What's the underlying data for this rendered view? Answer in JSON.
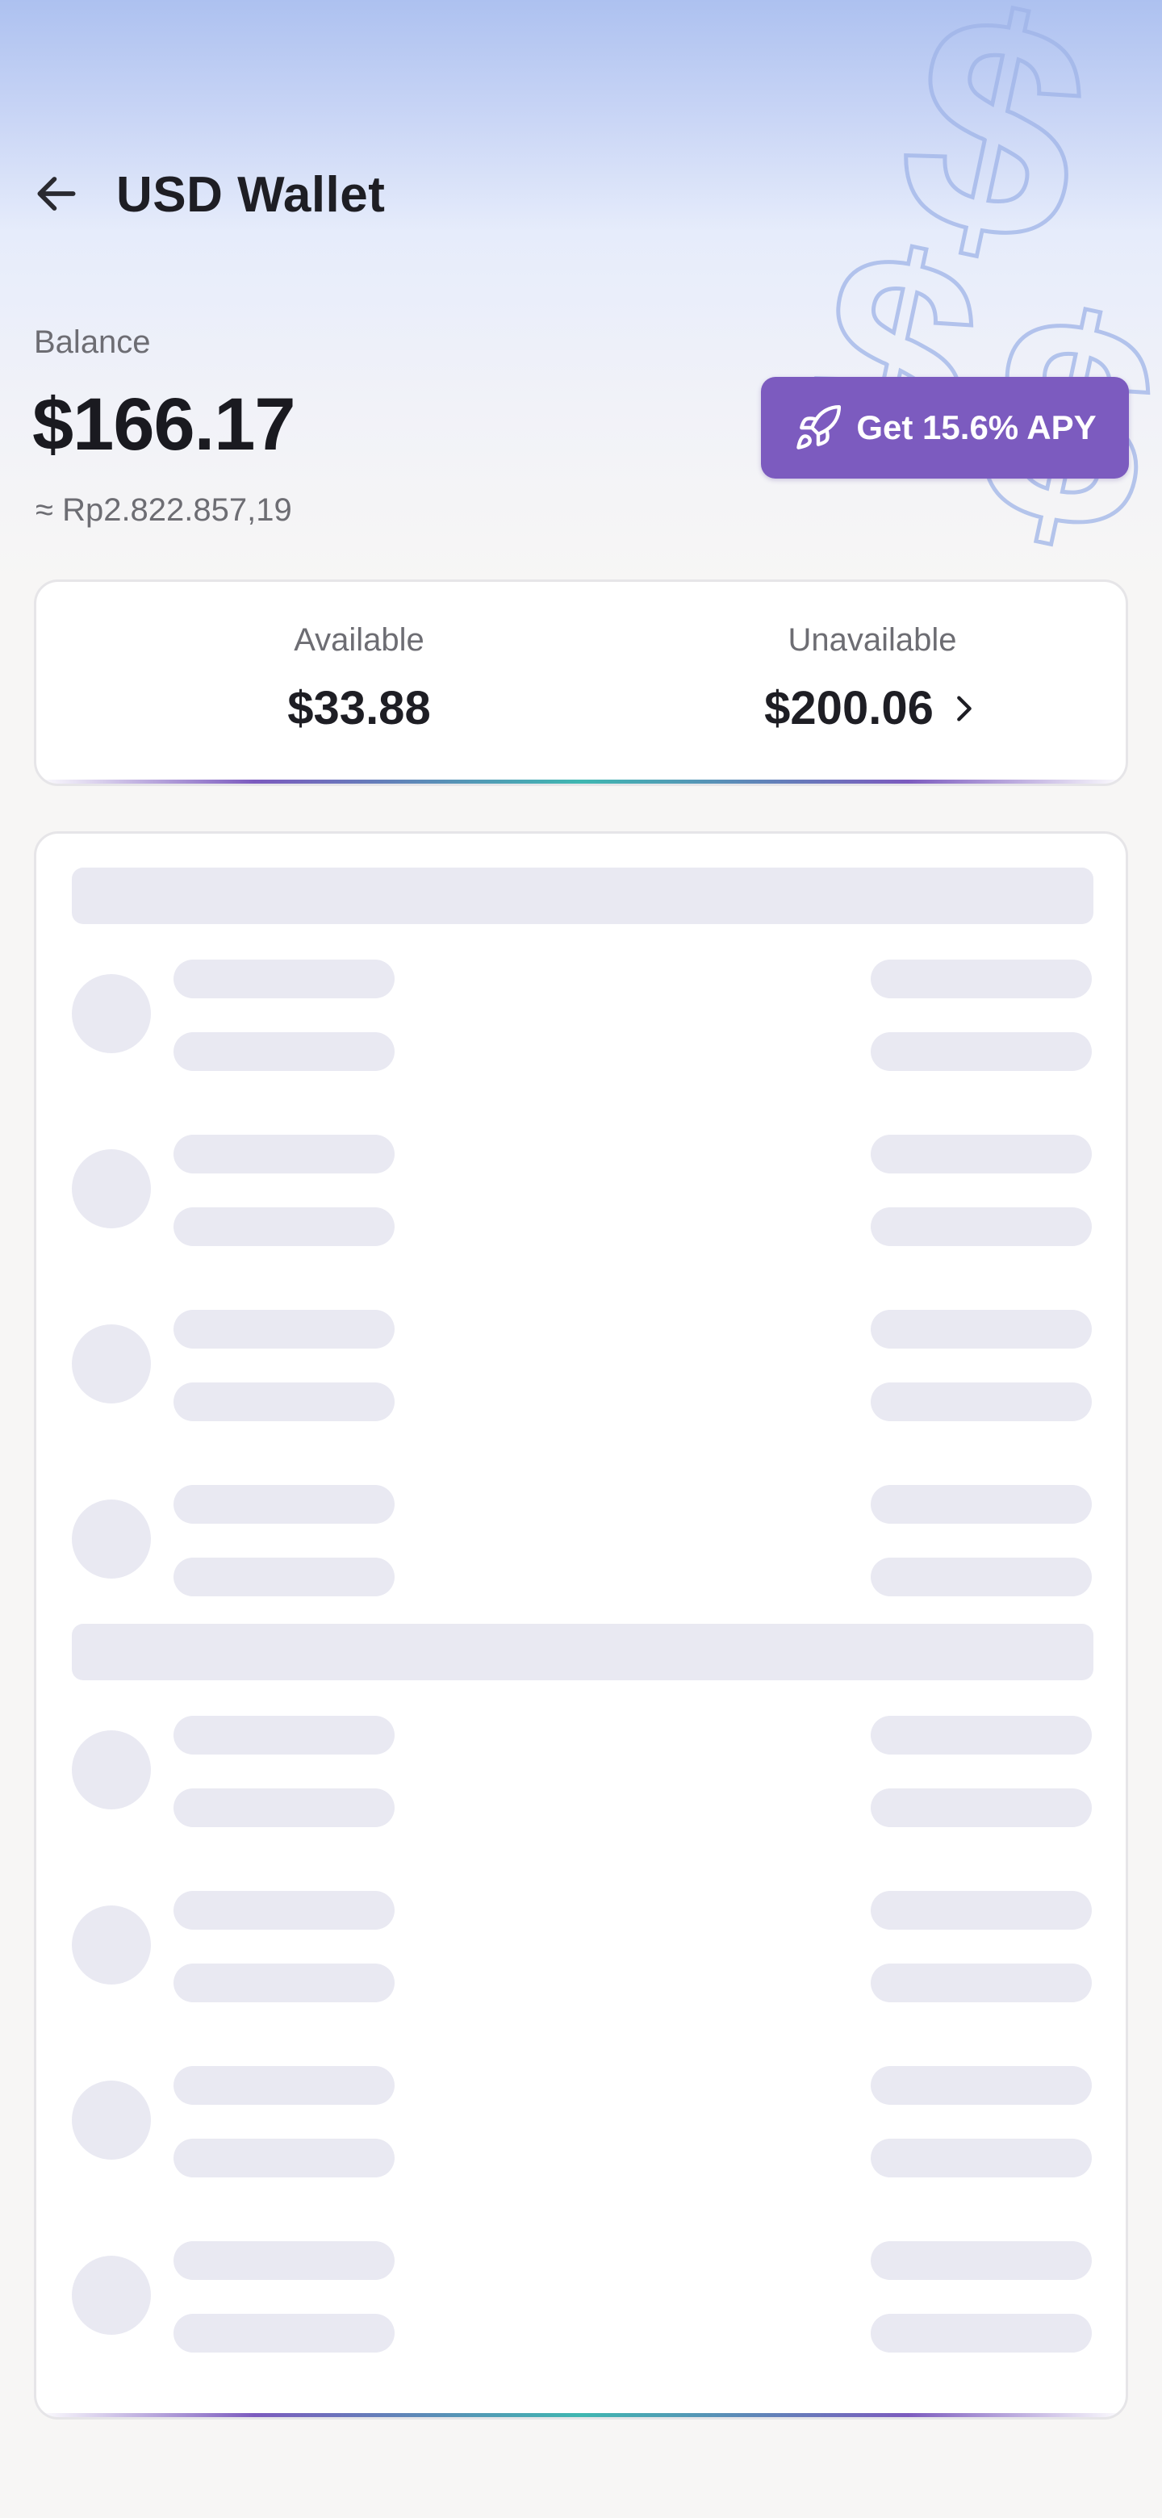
{
  "header": {
    "title": "USD Wallet",
    "back_icon": "arrow-left-icon"
  },
  "balance": {
    "label": "Balance",
    "value": "$166.17",
    "converted": "≈ Rp2.822.857,19"
  },
  "apy_button": {
    "label": "Get 15.6% APY",
    "icon": "rocket-icon"
  },
  "summary": {
    "available_label": "Available",
    "available_value": "$33.88",
    "unavailable_label": "Unavailable",
    "unavailable_value": "$200.06",
    "unavailable_icon": "chevron-right-icon"
  },
  "transactions": {
    "state": "loading",
    "groups": [
      {
        "placeholder_rows": 4
      },
      {
        "placeholder_rows": 4
      }
    ]
  },
  "colors": {
    "accent": "#7c5bbf",
    "accent_teal": "#3fb7b1",
    "skeleton": "#e9e9f2",
    "background": "#f7f6f5",
    "hero_top": "#adc1f0"
  }
}
